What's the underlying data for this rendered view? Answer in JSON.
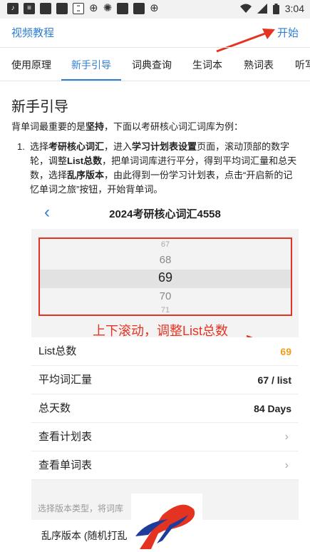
{
  "status_bar": {
    "left_icons": [
      "tiktok-icon",
      "notification-icon",
      "square-icon",
      "square-icon",
      "app-badge-icon",
      "chuxin-icon",
      "burst-icon",
      "square-icon",
      "square-icon",
      "chuxin-icon"
    ],
    "time": "3:04"
  },
  "top_bar": {
    "left_link": "视频教程",
    "right_link": "开始"
  },
  "tabs": [
    {
      "label": "使用原理",
      "active": false
    },
    {
      "label": "新手引导",
      "active": true
    },
    {
      "label": "词典查询",
      "active": false
    },
    {
      "label": "生词本",
      "active": false
    },
    {
      "label": "熟词表",
      "active": false
    },
    {
      "label": "听写",
      "active": false
    }
  ],
  "content": {
    "title": "新手引导",
    "p1_before": "背单词最重要的是",
    "p1_bold": "坚持",
    "p1_after": "，下面以考研核心词汇词库为例：",
    "step_num": "1.",
    "step_t1": "选择",
    "step_b1": "考研核心词汇",
    "step_t2": "，进入",
    "step_b2": "学习计划表设置",
    "step_t3": "页面，滚动顶部的数字轮，调整",
    "step_b3": "List总数",
    "step_t4": "，把单词词库进行平分，得到平均词汇量和总天数，选择",
    "step_b4": "乱序版本",
    "step_t5": "，由此得到一份学习计划表，点击“开启新的记忆单词之旅”按钮，开始背单词。"
  },
  "mockup": {
    "title": "2024考研核心词汇4558",
    "picker_values": [
      "67",
      "68",
      "69",
      "70",
      "71"
    ],
    "annotation": "上下滚动，调整List总数",
    "rows": [
      {
        "label": "List总数",
        "value": "69"
      },
      {
        "label": "平均词汇量",
        "value": "67 / list"
      },
      {
        "label": "总天数",
        "value": "84 Days"
      },
      {
        "label": "查看计划表",
        "value": "›"
      },
      {
        "label": "查看单词表",
        "value": "›"
      }
    ],
    "hint": "选择版本类型，将词库",
    "version_label": "乱序版本 (随机打乱",
    "accent_orange": "#f39b19",
    "annotation_red": "#e53322"
  },
  "colors": {
    "accent_blue": "#2f7fd6"
  }
}
